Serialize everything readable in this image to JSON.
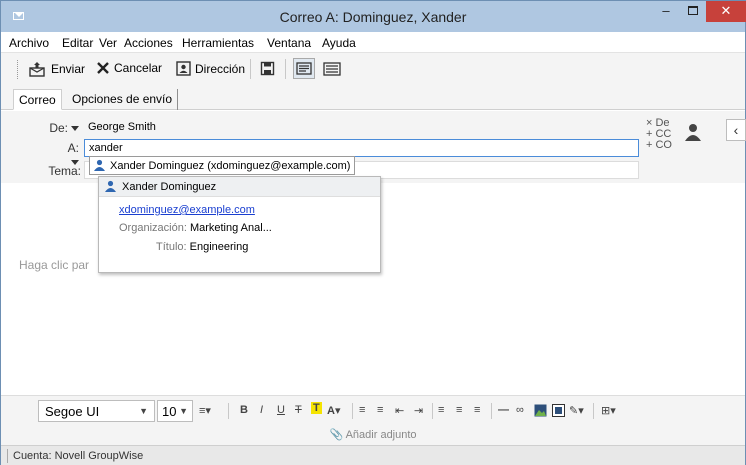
{
  "window": {
    "title": "Correo A: Dominguez, Xander",
    "minimize": "–",
    "close": "✕"
  },
  "menu": [
    "Archivo",
    "Editar",
    "Ver",
    "Acciones",
    "Herramientas",
    "Ventana",
    "Ayuda"
  ],
  "toolbar": {
    "send": "Enviar",
    "cancel": "Cancelar",
    "address": "Dirección"
  },
  "tabs": [
    "Correo",
    "Opciones de envío"
  ],
  "header": {
    "from_label": "De:",
    "from_value": "George Smith",
    "to_label": "A:",
    "to_value": "xander",
    "subject_label": "Tema:",
    "links": [
      "× De",
      "+ CC",
      "+ CO"
    ]
  },
  "suggestion": {
    "text": "Xander Dominguez (xdominguez@example.com)"
  },
  "contact_card": {
    "name": "Xander Dominguez",
    "email": "xdominguez@example.com",
    "org_label": "Organización:",
    "org_value": "Marketing Anal...",
    "title_label": "Título:",
    "title_value": "Engineering"
  },
  "body": {
    "placeholder": "Haga clic par"
  },
  "format": {
    "font": "Segoe UI",
    "size": "10"
  },
  "attach": "Añadir adjunto",
  "status": "Cuenta: Novell GroupWise",
  "colors": {
    "titlebar": "#afc7e1",
    "close": "#c7413b",
    "accent": "#4b8cd9",
    "person_icon": "#2f67b1"
  }
}
